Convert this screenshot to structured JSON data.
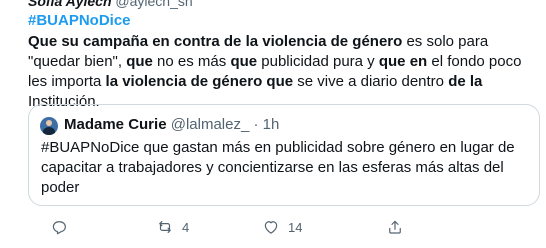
{
  "header": {
    "display_name": "Sofia Aylech",
    "handle": "@aylech_sh"
  },
  "hashtag": "#BUAPNoDice",
  "tweet": {
    "segments": [
      {
        "text": "Que su campaña en contra de la violencia de género",
        "bold": true
      },
      {
        "text": " es solo para \"quedar bien\", ",
        "bold": false
      },
      {
        "text": "que",
        "bold": true
      },
      {
        "text": " no es más ",
        "bold": false
      },
      {
        "text": "que",
        "bold": true
      },
      {
        "text": " publicidad pura y ",
        "bold": false
      },
      {
        "text": "que en",
        "bold": true
      },
      {
        "text": " el fondo poco les importa ",
        "bold": false
      },
      {
        "text": "la violencia de género que",
        "bold": true
      },
      {
        "text": " se vive a diario dentro ",
        "bold": false
      },
      {
        "text": "de la",
        "bold": true
      },
      {
        "text": " Institución.",
        "bold": false
      }
    ]
  },
  "quoted": {
    "name": "Madame Curie",
    "handle": "@lalmalez_",
    "separator": "·",
    "time": "1h",
    "text": "#BUAPNoDice que gastan más en publicidad sobre género en lugar de capacitar a trabajadores y concientizarse en las esferas más altas del poder"
  },
  "actions": {
    "reply_count": "",
    "retweet_count": "4",
    "like_count": "14",
    "share_count": ""
  }
}
